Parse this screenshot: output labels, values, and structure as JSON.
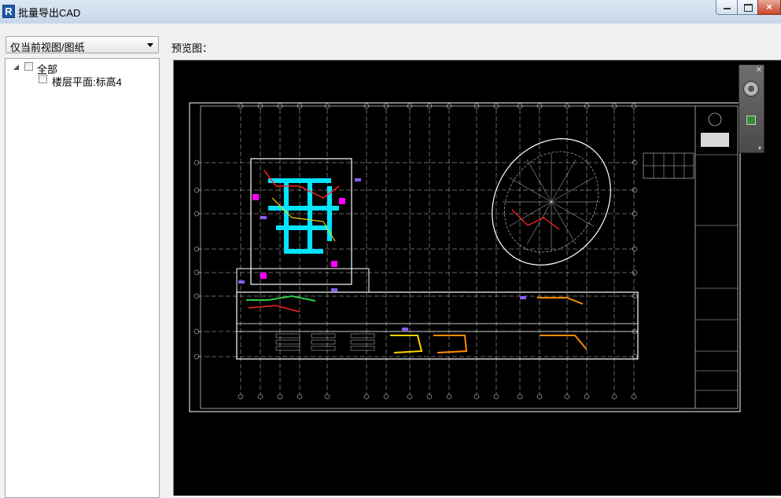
{
  "window": {
    "title": "批量导出CAD",
    "app_icon": "R",
    "controls": {
      "minimize": "minimize-icon",
      "maximize": "maximize-icon",
      "close": "×"
    }
  },
  "view_filter": {
    "selected": "仅当前视图/图纸"
  },
  "tree": {
    "root": {
      "label": "全部",
      "checked": false,
      "expanded": true
    },
    "children": [
      {
        "label": "楼层平面:标高4",
        "checked": false
      }
    ]
  },
  "preview": {
    "label": "预览图：",
    "background": "#000000",
    "nav_bar": {
      "icons": [
        "steering-wheel-icon",
        "pan-icon"
      ]
    }
  },
  "colors": {
    "drawing_line": "#ffffff",
    "duct_cyan": "#00e5ff",
    "duct_magenta": "#ff00ff",
    "pipe_red": "#ff2020",
    "pipe_yellow": "#ffd400",
    "pipe_green": "#2ecc40",
    "pipe_orange": "#ff8c00",
    "label_purple": "#8a5cff"
  }
}
